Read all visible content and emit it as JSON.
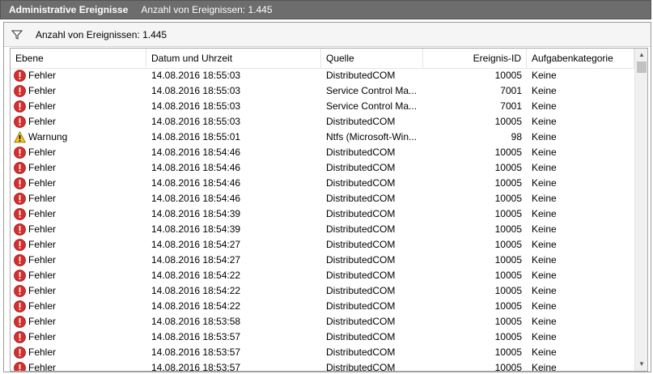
{
  "title": {
    "view_name": "Administrative Ereignisse",
    "count_text": "Anzahl von Ereignissen: 1.445"
  },
  "filter": {
    "text": "Anzahl von Ereignissen: 1.445",
    "icon": "filter-icon"
  },
  "columns": {
    "level": "Ebene",
    "datetime": "Datum und Uhrzeit",
    "source": "Quelle",
    "event_id": "Ereignis-ID",
    "category": "Aufgabenkategorie"
  },
  "colors": {
    "titlebar_bg": "#6d6d6d",
    "error": "#d32f2f",
    "warning": "#f4c430"
  },
  "events": [
    {
      "level": "Fehler",
      "icon": "error",
      "datetime": "14.08.2016 18:55:03",
      "source": "DistributedCOM",
      "event_id": "10005",
      "category": "Keine"
    },
    {
      "level": "Fehler",
      "icon": "error",
      "datetime": "14.08.2016 18:55:03",
      "source": "Service Control Ma...",
      "event_id": "7001",
      "category": "Keine"
    },
    {
      "level": "Fehler",
      "icon": "error",
      "datetime": "14.08.2016 18:55:03",
      "source": "Service Control Ma...",
      "event_id": "7001",
      "category": "Keine"
    },
    {
      "level": "Fehler",
      "icon": "error",
      "datetime": "14.08.2016 18:55:03",
      "source": "DistributedCOM",
      "event_id": "10005",
      "category": "Keine"
    },
    {
      "level": "Warnung",
      "icon": "warning",
      "datetime": "14.08.2016 18:55:01",
      "source": "Ntfs (Microsoft-Win...",
      "event_id": "98",
      "category": "Keine"
    },
    {
      "level": "Fehler",
      "icon": "error",
      "datetime": "14.08.2016 18:54:46",
      "source": "DistributedCOM",
      "event_id": "10005",
      "category": "Keine"
    },
    {
      "level": "Fehler",
      "icon": "error",
      "datetime": "14.08.2016 18:54:46",
      "source": "DistributedCOM",
      "event_id": "10005",
      "category": "Keine"
    },
    {
      "level": "Fehler",
      "icon": "error",
      "datetime": "14.08.2016 18:54:46",
      "source": "DistributedCOM",
      "event_id": "10005",
      "category": "Keine"
    },
    {
      "level": "Fehler",
      "icon": "error",
      "datetime": "14.08.2016 18:54:46",
      "source": "DistributedCOM",
      "event_id": "10005",
      "category": "Keine"
    },
    {
      "level": "Fehler",
      "icon": "error",
      "datetime": "14.08.2016 18:54:39",
      "source": "DistributedCOM",
      "event_id": "10005",
      "category": "Keine"
    },
    {
      "level": "Fehler",
      "icon": "error",
      "datetime": "14.08.2016 18:54:39",
      "source": "DistributedCOM",
      "event_id": "10005",
      "category": "Keine"
    },
    {
      "level": "Fehler",
      "icon": "error",
      "datetime": "14.08.2016 18:54:27",
      "source": "DistributedCOM",
      "event_id": "10005",
      "category": "Keine"
    },
    {
      "level": "Fehler",
      "icon": "error",
      "datetime": "14.08.2016 18:54:27",
      "source": "DistributedCOM",
      "event_id": "10005",
      "category": "Keine"
    },
    {
      "level": "Fehler",
      "icon": "error",
      "datetime": "14.08.2016 18:54:22",
      "source": "DistributedCOM",
      "event_id": "10005",
      "category": "Keine"
    },
    {
      "level": "Fehler",
      "icon": "error",
      "datetime": "14.08.2016 18:54:22",
      "source": "DistributedCOM",
      "event_id": "10005",
      "category": "Keine"
    },
    {
      "level": "Fehler",
      "icon": "error",
      "datetime": "14.08.2016 18:54:22",
      "source": "DistributedCOM",
      "event_id": "10005",
      "category": "Keine"
    },
    {
      "level": "Fehler",
      "icon": "error",
      "datetime": "14.08.2016 18:53:58",
      "source": "DistributedCOM",
      "event_id": "10005",
      "category": "Keine"
    },
    {
      "level": "Fehler",
      "icon": "error",
      "datetime": "14.08.2016 18:53:57",
      "source": "DistributedCOM",
      "event_id": "10005",
      "category": "Keine"
    },
    {
      "level": "Fehler",
      "icon": "error",
      "datetime": "14.08.2016 18:53:57",
      "source": "DistributedCOM",
      "event_id": "10005",
      "category": "Keine"
    },
    {
      "level": "Fehler",
      "icon": "error",
      "datetime": "14.08.2016 18:53:57",
      "source": "DistributedCOM",
      "event_id": "10005",
      "category": "Keine"
    }
  ]
}
